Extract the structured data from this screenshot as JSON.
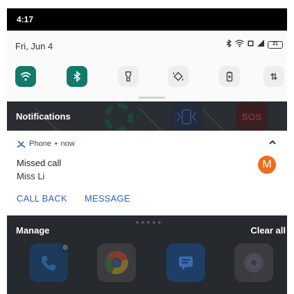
{
  "status_bar": {
    "time": "4:17"
  },
  "quick_settings": {
    "date": "Fri, Jun 4",
    "battery_level": "21",
    "tiles": [
      {
        "name": "wifi",
        "active": true
      },
      {
        "name": "bluetooth",
        "active": true
      },
      {
        "name": "flashlight",
        "active": false
      },
      {
        "name": "auto-rotate",
        "active": false
      },
      {
        "name": "battery-saver",
        "active": false
      },
      {
        "name": "mobile-data",
        "active": false
      }
    ]
  },
  "notifications_header": {
    "label": "Notifications",
    "sos_text": "SOS"
  },
  "notification": {
    "app_name": "Phone",
    "time": "now",
    "title": "Missed call",
    "body": "Miss Li",
    "avatar_letter": "M",
    "actions": [
      "CALL BACK",
      "MESSAGE"
    ]
  },
  "footer": {
    "manage_label": "Manage",
    "clear_all_label": "Clear all"
  },
  "colors": {
    "accent": "#127a68",
    "action_blue": "#2e63c4",
    "avatar_orange": "#ef6c1a"
  }
}
